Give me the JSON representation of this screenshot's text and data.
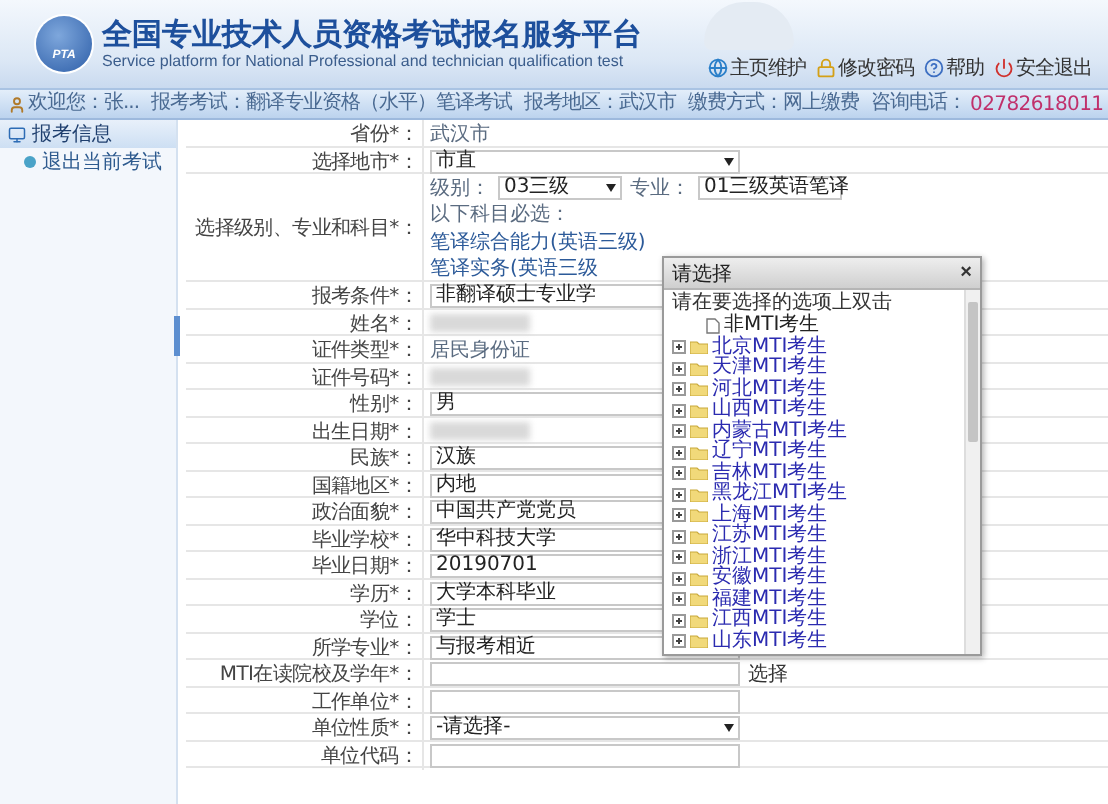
{
  "header": {
    "logo_text": "PTA",
    "title": "全国专业技术人员资格考试报名服务平台",
    "subtitle": "Service platform for National Professional and technician qualification test",
    "links": [
      {
        "kind": "globe",
        "label": "主页维护"
      },
      {
        "kind": "lock",
        "label": "修改密码"
      },
      {
        "kind": "help",
        "label": "帮助"
      },
      {
        "kind": "power",
        "label": "安全退出"
      }
    ]
  },
  "info_bar": {
    "welcome": "欢迎您：张...",
    "items": [
      "报考考试：翻译专业资格（水平）笔译考试",
      "报考地区：武汉市",
      "缴费方式：网上缴费"
    ],
    "phone_label": "咨询电话：",
    "phone": "02782618011"
  },
  "sidebar": {
    "title": "报考信息",
    "items": [
      {
        "label": "退出当前考试"
      }
    ]
  },
  "form": {
    "rows": [
      {
        "label": "省份*：",
        "kind": "text",
        "value": "武汉市"
      },
      {
        "label": "选择地市*：",
        "kind": "select",
        "value": "市直"
      },
      {
        "label": "选择级别、专业和科目*：",
        "kind": "level",
        "selects": [
          {
            "label": "级别：",
            "value": "03三级"
          },
          {
            "label": "专业：",
            "value": "01三级英语笔译"
          }
        ],
        "note": "以下科目必选：",
        "subjects": [
          "笔译综合能力(英语三级)",
          "笔译实务(英语三级"
        ]
      },
      {
        "label": "报考条件*：",
        "kind": "select",
        "value": "非翻译硕士专业学"
      },
      {
        "label": "姓名*：",
        "kind": "redacted"
      },
      {
        "label": "证件类型*：",
        "kind": "text",
        "value": "居民身份证"
      },
      {
        "label": "证件号码*：",
        "kind": "redacted"
      },
      {
        "label": "性别*：",
        "kind": "input",
        "value": "男"
      },
      {
        "label": "出生日期*：",
        "kind": "redacted"
      },
      {
        "label": "民族*：",
        "kind": "input",
        "value": "汉族"
      },
      {
        "label": "国籍地区*：",
        "kind": "input",
        "value": "内地"
      },
      {
        "label": "政治面貌*：",
        "kind": "input",
        "value": "中国共产党党员"
      },
      {
        "label": "毕业学校*：",
        "kind": "input",
        "value": "华中科技大学"
      },
      {
        "label": "毕业日期*：",
        "kind": "input",
        "value": "20190701"
      },
      {
        "label": "学历*：",
        "kind": "input",
        "value": "大学本科毕业"
      },
      {
        "label": "学位：",
        "kind": "input",
        "value": "学士"
      },
      {
        "label": "所学专业*：",
        "kind": "select",
        "value": "与报考相近"
      },
      {
        "label": "MTI在读院校及学年*：",
        "kind": "input",
        "action": "选择"
      },
      {
        "label": "工作单位*：",
        "kind": "input"
      },
      {
        "label": "单位性质*：",
        "kind": "select",
        "value": "-请选择-"
      },
      {
        "label": "单位代码：",
        "kind": "input"
      }
    ]
  },
  "dialog": {
    "title": "请选择",
    "close": "×",
    "instruction": "请在要选择的选项上双击",
    "items": [
      {
        "kind": "file",
        "label": "非MTI考生"
      },
      {
        "kind": "folder",
        "label": "北京MTI考生",
        "expanded": false
      },
      {
        "kind": "folder",
        "label": "天津MTI考生",
        "expanded": false
      },
      {
        "kind": "folder",
        "label": "河北MTI考生",
        "expanded": false
      },
      {
        "kind": "folder",
        "label": "山西MTI考生",
        "expanded": false
      },
      {
        "kind": "folder",
        "label": "内蒙古MTI考生",
        "expanded": false
      },
      {
        "kind": "folder",
        "label": "辽宁MTI考生",
        "expanded": false
      },
      {
        "kind": "folder",
        "label": "吉林MTI考生",
        "expanded": false
      },
      {
        "kind": "folder",
        "label": "黑龙江MTI考生",
        "expanded": false
      },
      {
        "kind": "folder",
        "label": "上海MTI考生",
        "expanded": false
      },
      {
        "kind": "folder",
        "label": "江苏MTI考生",
        "expanded": false
      },
      {
        "kind": "folder",
        "label": "浙江MTI考生",
        "expanded": false
      },
      {
        "kind": "folder",
        "label": "安徽MTI考生",
        "expanded": false
      },
      {
        "kind": "folder",
        "label": "福建MTI考生",
        "expanded": false
      },
      {
        "kind": "folder",
        "label": "江西MTI考生",
        "expanded": false
      },
      {
        "kind": "folder",
        "label": "山东MTI考生",
        "expanded": false
      }
    ]
  }
}
